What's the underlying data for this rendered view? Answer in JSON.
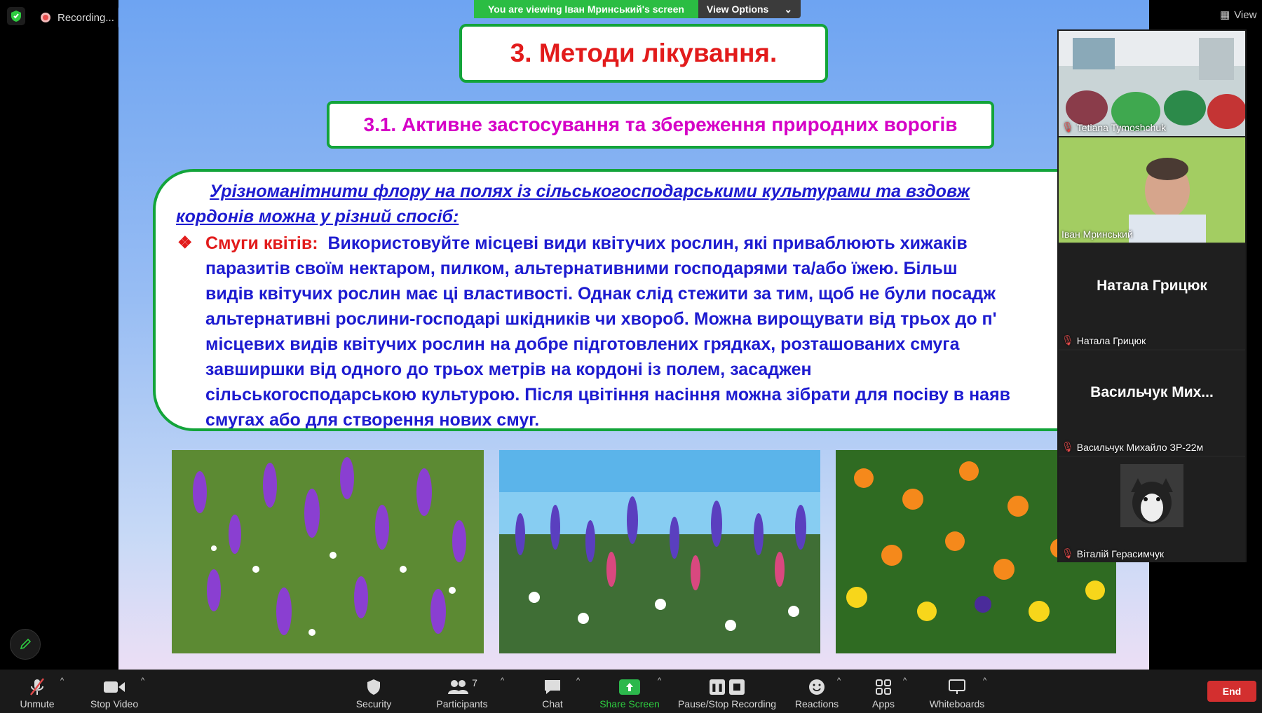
{
  "recording": {
    "label": "Recording..."
  },
  "share": {
    "viewing_text": "You are viewing Іван Мринський's screen",
    "view_options": "View Options"
  },
  "slide": {
    "title": "3. Методи лікування.",
    "subtitle": "3.1. Активне застосування та збереження природних ворогів",
    "intro_line1": "Урізноманітнити флору на полях із сільськогосподарськими культурами та вздовж",
    "intro_line2": "кордонів можна у різний спосіб:",
    "bullet_label": "Смуги квітів:",
    "bullet_lines": [
      "Використовуйте місцеві види квітучих рослин, які приваблюють хижаків",
      "паразитів своїм нектаром, пилком, альтернативними господарями та/або їжею. Більш",
      "видів квітучих рослин має ці властивості. Однак слід стежити за тим, щоб не були посадж",
      "альтернативні рослини-господарі шкідників чи хвороб. Можна вирощувати від трьох до п'",
      "місцевих видів квітучих рослин на добре підготовлених грядках, розташованих смуга",
      "завширшки від одного до трьох метрів на кордоні із полем, засаджен",
      "сільськогосподарською культурою. Після цвітіння насіння можна зібрати для посіву в наяв",
      "смугах або для створення нових смуг."
    ]
  },
  "view_button": "View",
  "participants": [
    {
      "name": "Tetiana Tymoshchuk",
      "type": "video"
    },
    {
      "name": "Іван Мринський",
      "type": "video"
    },
    {
      "name": "Натала Грицюк",
      "display": "Натала Грицюк",
      "type": "name"
    },
    {
      "name": "Васильчук Михайло ЗР-22м",
      "display": "Васильчук Мих...",
      "type": "name"
    },
    {
      "name": "Віталій Герасимчук",
      "type": "avatar"
    }
  ],
  "toolbar": {
    "unmute": "Unmute",
    "stop_video": "Stop Video",
    "security": "Security",
    "participants": "Participants",
    "participants_count": "7",
    "chat": "Chat",
    "share_screen": "Share Screen",
    "pause_stop_recording": "Pause/Stop Recording",
    "reactions": "Reactions",
    "apps": "Apps",
    "whiteboards": "Whiteboards",
    "end": "End"
  },
  "colors": {
    "green_border": "#13a43a",
    "title_red": "#e21b1b",
    "subtitle_magenta": "#d500c6",
    "text_blue": "#1d1bd0",
    "end_red": "#d32f2f"
  }
}
